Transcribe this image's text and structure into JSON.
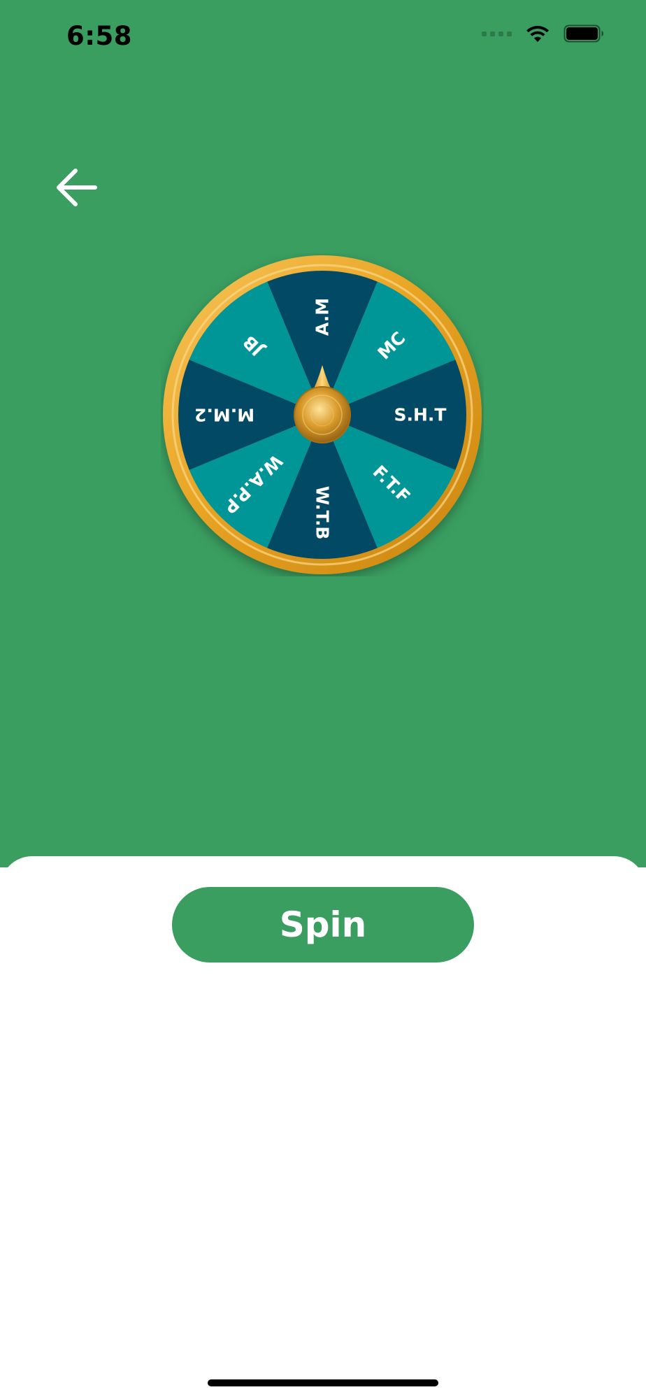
{
  "status_bar": {
    "time": "6:58",
    "icons": [
      "signal-dots-icon",
      "wifi-icon",
      "battery-icon"
    ]
  },
  "navigation": {
    "back_icon": "arrow-left-icon"
  },
  "wheel": {
    "segments": [
      {
        "label": "A.M",
        "color": "#024966"
      },
      {
        "label": "MC",
        "color": "#009596"
      },
      {
        "label": "S.H.T",
        "color": "#024966"
      },
      {
        "label": "F.T.F",
        "color": "#009596"
      },
      {
        "label": "W.T.B",
        "color": "#024966"
      },
      {
        "label": "W.A.P.P",
        "color": "#009596"
      },
      {
        "label": "M.M.2",
        "color": "#024966"
      },
      {
        "label": "JB",
        "color": "#009596"
      }
    ],
    "rim_color": "#e8a31c",
    "pointer_color": "#d99a1e"
  },
  "actions": {
    "spin_label": "Spin"
  },
  "colors": {
    "background": "#3a9e60",
    "sheet": "#ffffff",
    "button": "#3a9e60"
  }
}
